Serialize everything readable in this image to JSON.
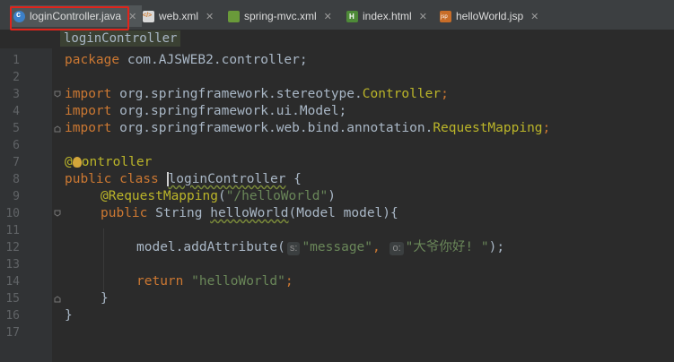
{
  "tabs": [
    {
      "label": "loginController.java",
      "icon": "java-class-icon",
      "active": true
    },
    {
      "label": "web.xml",
      "icon": "xml-file-icon",
      "active": false
    },
    {
      "label": "spring-mvc.xml",
      "icon": "spring-xml-icon",
      "active": false
    },
    {
      "label": "index.html",
      "icon": "html-file-icon",
      "active": false
    },
    {
      "label": "helloWorld.jsp",
      "icon": "jsp-file-icon",
      "active": false
    }
  ],
  "close_glyph": "✕",
  "breadcrumb": "loginController",
  "line_numbers": [
    "1",
    "2",
    "3",
    "4",
    "5",
    "6",
    "7",
    "8",
    "9",
    "10",
    "11",
    "12",
    "13",
    "14",
    "15",
    "16",
    "17"
  ],
  "code": {
    "l1_kw": "package",
    "l1_rest": " com.AJSWEB2.controller;",
    "l3_kw": "import",
    "l3_pkg": " org.springframework.stereotype.",
    "l3_cls": "Controller",
    "l3_end": ";",
    "l4_kw": "import",
    "l4_pkg": " org.springframework.ui.Model;",
    "l5_kw": "import",
    "l5_pkg": " org.springframework.web.bind.annotation.",
    "l5_cls": "RequestMapping",
    "l5_end": ";",
    "l7_at": "@",
    "l7_ann": "ontroller",
    "l8_kw": "public class ",
    "l8_name": "loginController",
    "l8_end": " {",
    "l9_ann": "@RequestMapping",
    "l9_open": "(",
    "l9_str": "\"/helloWorld\"",
    "l9_close": ")",
    "l10_kw": "public ",
    "l10_type": "String ",
    "l10_name": "helloWorld",
    "l10_params": "(Model model){",
    "l12_call": "model.addAttribute(",
    "l12_hint1": "s:",
    "l12_str1": "\"message\"",
    "l12_comma": ", ",
    "l12_hint2": "o:",
    "l12_str2": "\"大爷你好! \"",
    "l12_end": ");",
    "l14_kw": "return ",
    "l14_str": "\"helloWorld\"",
    "l14_end": ";",
    "l15_brace": "}",
    "l16_brace": "}"
  },
  "colors": {
    "keyword": "#cc7832",
    "string": "#6a8759",
    "annotation": "#bbb529",
    "text": "#a9b7c6",
    "highlight_box": "#e0241b"
  }
}
